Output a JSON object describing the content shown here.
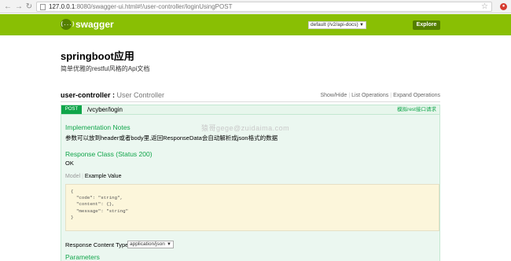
{
  "browser": {
    "url_host": "127.0.0.1",
    "url_path": ":8080/swagger-ui.html#!/user-controller/loginUsingPOST",
    "nav_icons": [
      "back-icon",
      "forward-icon",
      "reload-icon"
    ],
    "star_icon": "star-icon",
    "extension_icon": "extension-icon"
  },
  "header": {
    "logo_icon": "{...}",
    "logo_text": "swagger",
    "api_select": "default (/v2/api-docs)",
    "explore_label": "Explore",
    "bg_color": "#89bf04"
  },
  "info": {
    "title": "springboot应用",
    "description": "简单优雅的restful风格的Api文档"
  },
  "resource": {
    "name": "user-controller",
    "separator": " : ",
    "description": "User Controller",
    "actions": [
      "Show/Hide",
      "List Operations",
      "Expand Operations"
    ]
  },
  "operation": {
    "method": "POST",
    "path": "/vcyber/login",
    "summary": "模拟rest接口请求",
    "method_color": "#10a54a",
    "implementation_notes_title": "Implementation Notes",
    "implementation_notes": "参数可以放到header或者body里,返回ResponseData会自动解析成json格式的数据",
    "response_class_title": "Response Class (Status 200)",
    "response_class_value": "OK",
    "model_tabs": [
      "Model",
      "Example Value"
    ],
    "example_value": "{\n  \"code\": \"string\",\n  \"content\": {},\n  \"message\": \"string\"\n}",
    "response_content_type_label": "Response Content Type",
    "response_content_type": "application/json",
    "parameters_title": "Parameters"
  },
  "watermark": "猿哥gege@zuidaima.com"
}
